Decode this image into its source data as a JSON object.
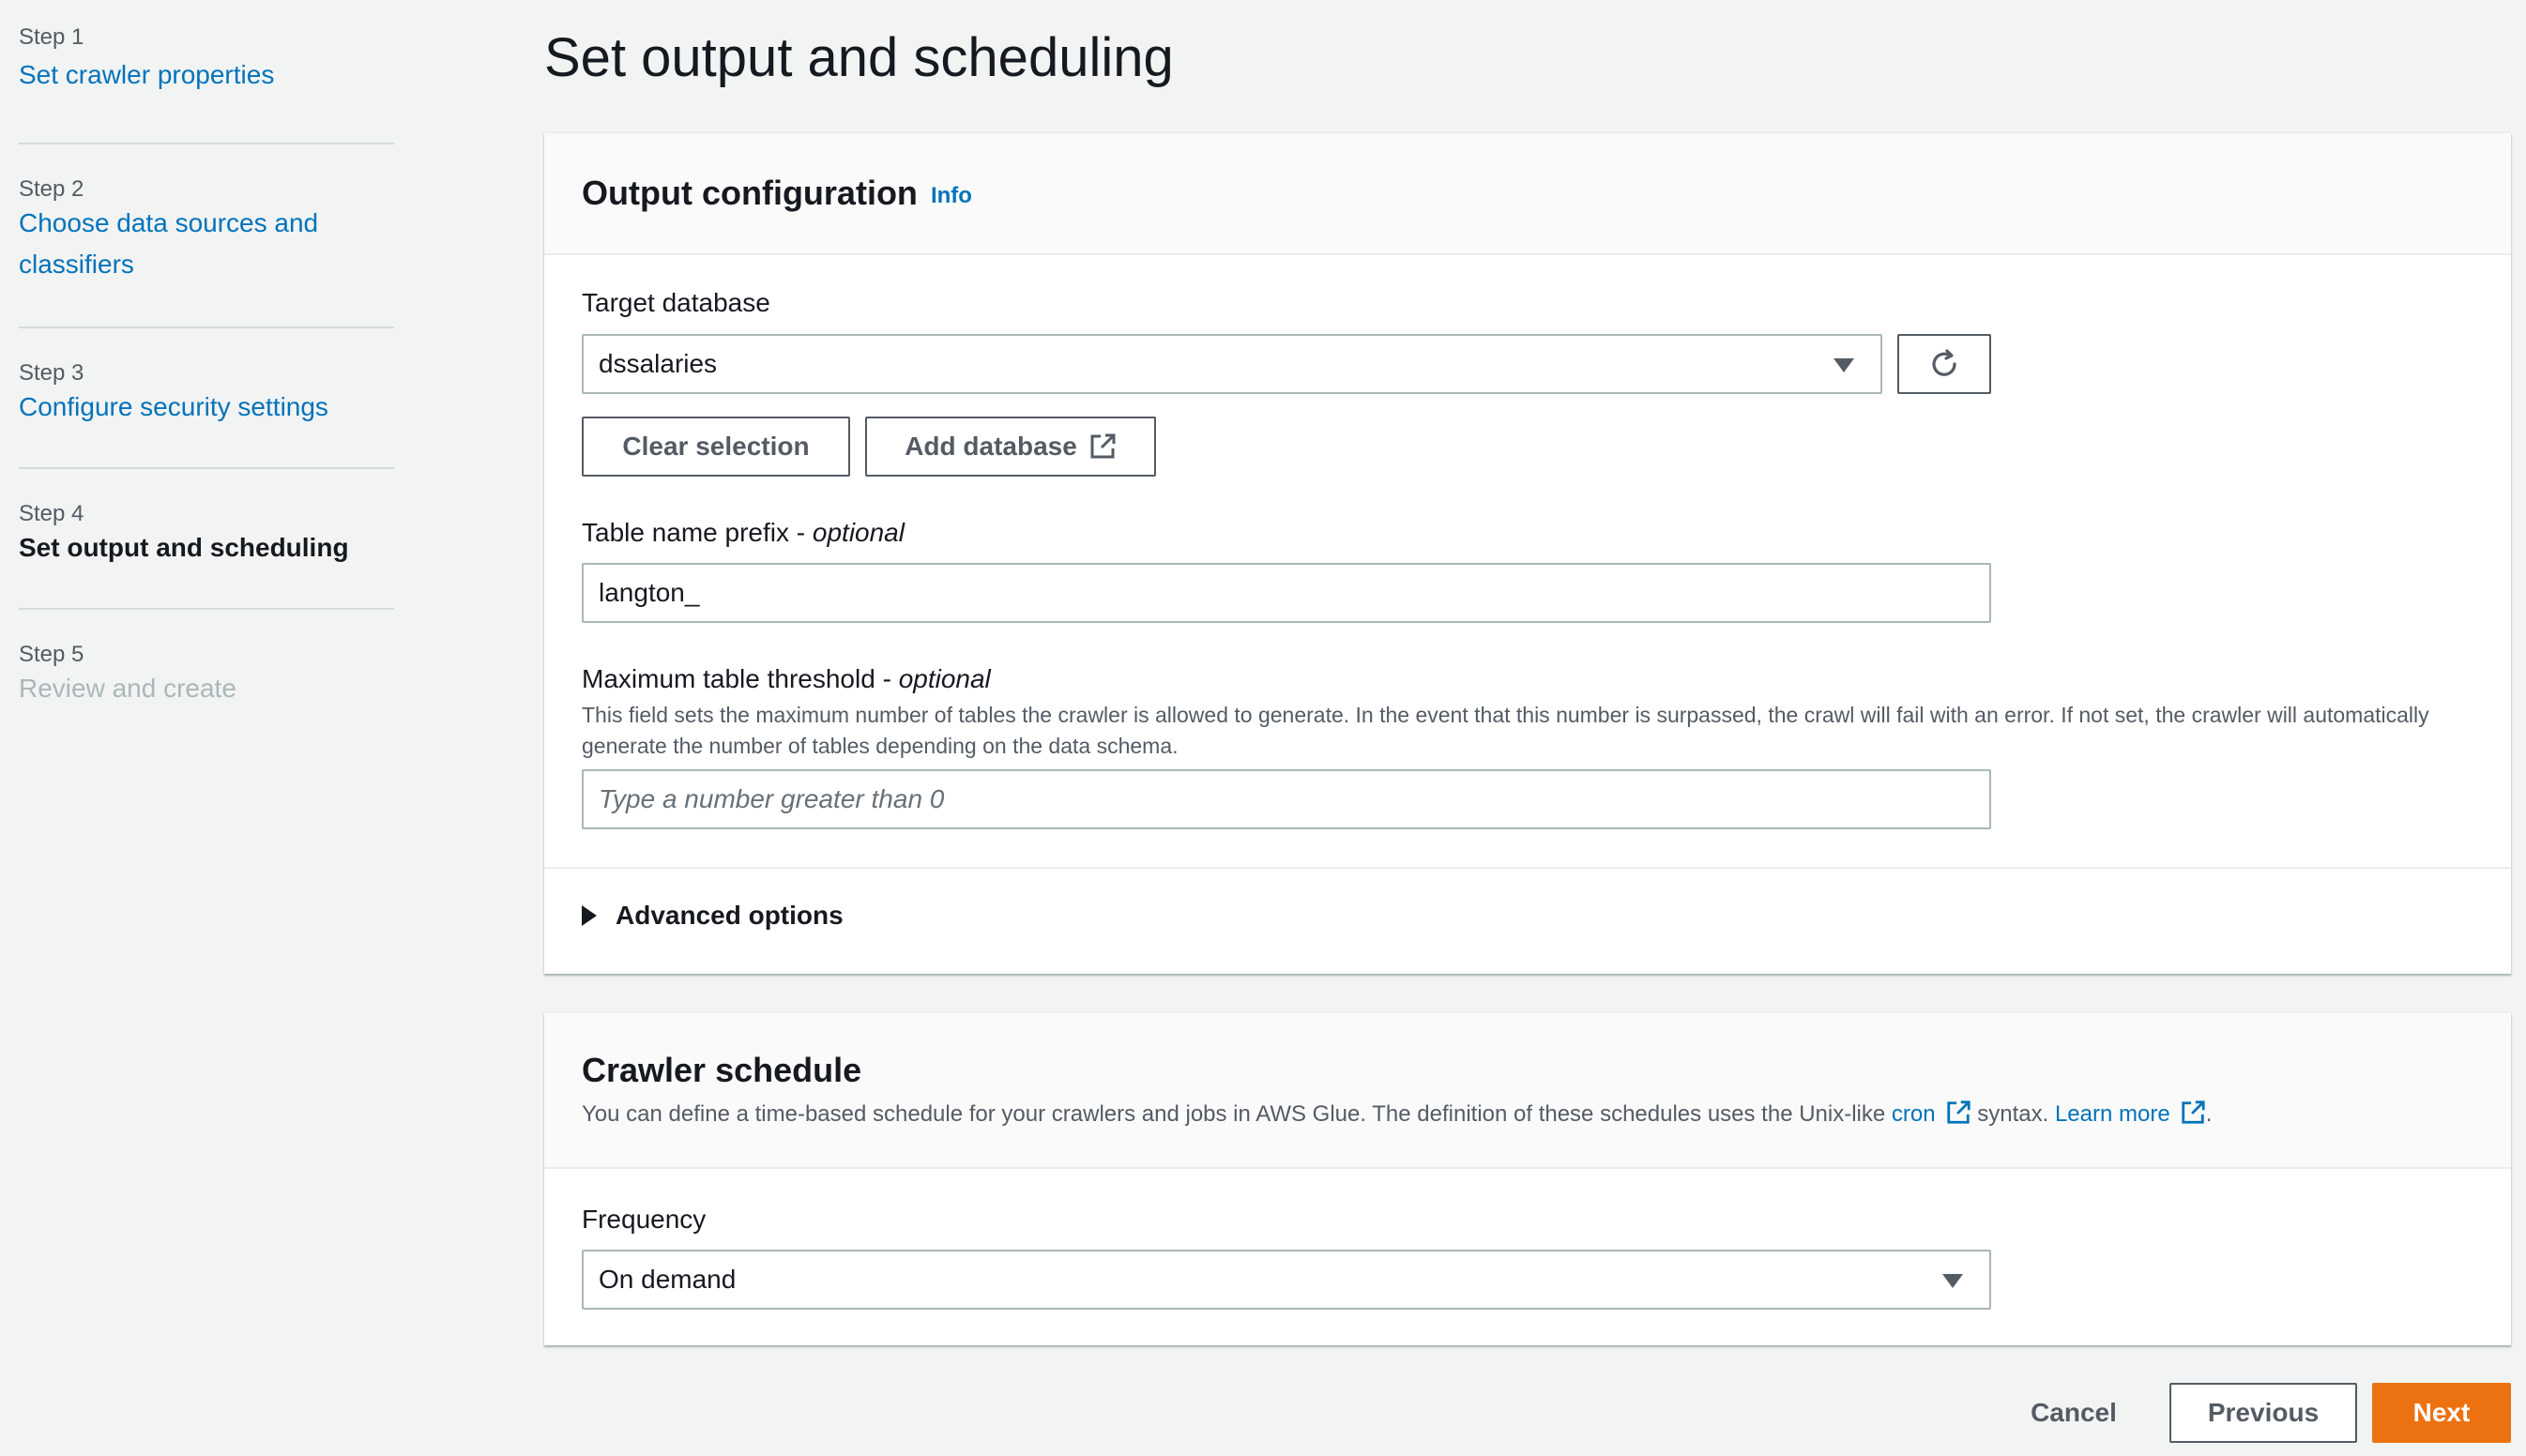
{
  "steps": [
    {
      "num": "Step 1",
      "label": "Set crawler properties"
    },
    {
      "num": "Step 2",
      "label": "Choose data sources and classifiers"
    },
    {
      "num": "Step 3",
      "label": "Configure security settings"
    },
    {
      "num": "Step 4",
      "label": "Set output and scheduling"
    },
    {
      "num": "Step 5",
      "label": "Review and create"
    }
  ],
  "page_title": "Set output and scheduling",
  "output_config": {
    "title": "Output configuration",
    "info": "Info",
    "target_db_label": "Target database",
    "target_db_value": "dssalaries",
    "clear_selection": "Clear selection",
    "add_database": "Add database",
    "prefix_label": "Table name prefix - ",
    "prefix_optional": "optional",
    "prefix_value": "langton_",
    "threshold_label": "Maximum table threshold - ",
    "threshold_optional": "optional",
    "threshold_desc": "This field sets the maximum number of tables the crawler is allowed to generate. In the event that this number is surpassed, the crawl will fail with an error. If not set, the crawler will automatically generate the number of tables depending on the data schema.",
    "threshold_placeholder": "Type a number greater than 0",
    "advanced_options": "Advanced options"
  },
  "schedule": {
    "title": "Crawler schedule",
    "desc_prefix": "You can define a time-based schedule for your crawlers and jobs in AWS Glue. The definition of these schedules uses the Unix-like ",
    "cron_link": "cron",
    "desc_middle": " syntax. ",
    "learn_more": "Learn more",
    "desc_suffix": ".",
    "frequency_label": "Frequency",
    "frequency_value": "On demand"
  },
  "footer": {
    "cancel": "Cancel",
    "previous": "Previous",
    "next": "Next"
  },
  "colors": {
    "link": "#0073bb",
    "primary_button": "#ec7211",
    "background": "#f2f3f3"
  },
  "icons": [
    "refresh-icon",
    "external-link-icon",
    "caret-down-icon",
    "caret-right-icon"
  ]
}
